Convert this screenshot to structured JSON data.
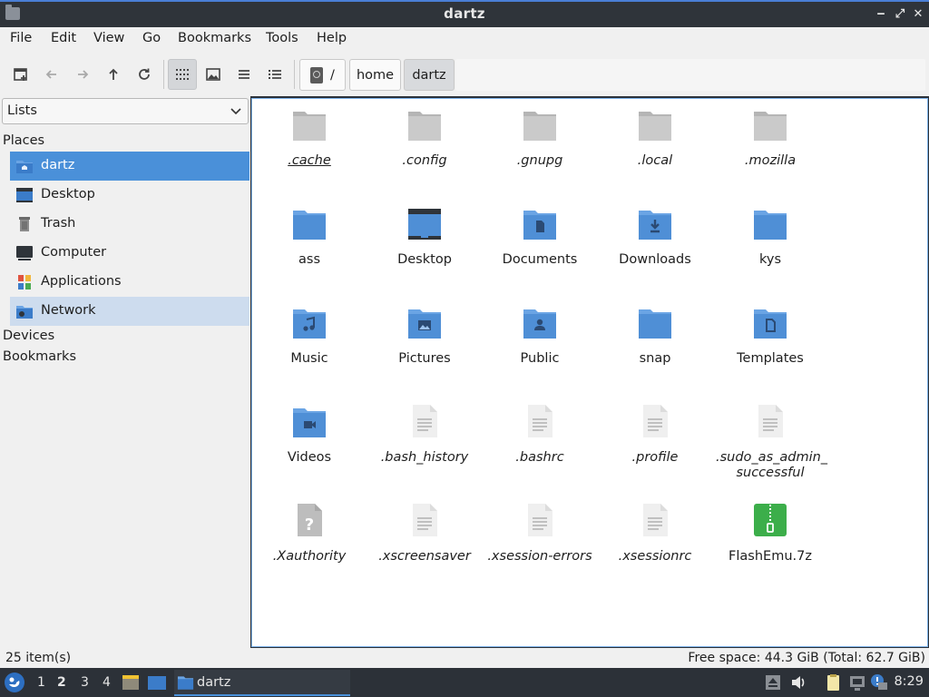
{
  "window": {
    "title": "dartz"
  },
  "menu": [
    "File",
    "Edit",
    "View",
    "Go",
    "Bookmarks",
    "Tools",
    "Help"
  ],
  "toolbar": {
    "buttons": [
      "new-tab-icon",
      "back-icon",
      "forward-icon",
      "up-icon",
      "reload-icon",
      "icon-view-icon",
      "thumbnail-view-icon",
      "compact-view-icon",
      "detailed-list-icon"
    ],
    "active_view": "icon-view-icon",
    "path": {
      "root": "/",
      "crumbs": [
        "home",
        "dartz"
      ],
      "current": "dartz"
    }
  },
  "sidebar": {
    "mode": "Lists",
    "places_label": "Places",
    "places": [
      {
        "label": "dartz",
        "icon": "home-folder-icon",
        "state": "selected"
      },
      {
        "label": "Desktop",
        "icon": "desktop-icon",
        "state": ""
      },
      {
        "label": "Trash",
        "icon": "trash-icon",
        "state": ""
      },
      {
        "label": "Computer",
        "icon": "computer-icon",
        "state": ""
      },
      {
        "label": "Applications",
        "icon": "applications-icon",
        "state": ""
      },
      {
        "label": "Network",
        "icon": "network-icon",
        "state": "hover"
      }
    ],
    "devices_label": "Devices",
    "bookmarks_label": "Bookmarks"
  },
  "files": [
    {
      "name": ".cache",
      "icon": "grey-folder-icon",
      "hidden": true
    },
    {
      "name": ".config",
      "icon": "grey-folder-icon",
      "hidden": true
    },
    {
      "name": ".gnupg",
      "icon": "grey-folder-icon",
      "hidden": true
    },
    {
      "name": ".local",
      "icon": "grey-folder-icon",
      "hidden": true
    },
    {
      "name": ".mozilla",
      "icon": "grey-folder-icon",
      "hidden": true
    },
    {
      "name": "ass",
      "icon": "folder-icon",
      "hidden": false
    },
    {
      "name": "Desktop",
      "icon": "desktop-folder-icon",
      "hidden": false
    },
    {
      "name": "Documents",
      "icon": "documents-folder-icon",
      "hidden": false
    },
    {
      "name": "Downloads",
      "icon": "downloads-folder-icon",
      "hidden": false
    },
    {
      "name": "kys",
      "icon": "folder-icon",
      "hidden": false
    },
    {
      "name": "Music",
      "icon": "music-folder-icon",
      "hidden": false
    },
    {
      "name": "Pictures",
      "icon": "pictures-folder-icon",
      "hidden": false
    },
    {
      "name": "Public",
      "icon": "public-folder-icon",
      "hidden": false
    },
    {
      "name": "snap",
      "icon": "folder-icon",
      "hidden": false
    },
    {
      "name": "Templates",
      "icon": "templates-folder-icon",
      "hidden": false
    },
    {
      "name": "Videos",
      "icon": "videos-folder-icon",
      "hidden": false
    },
    {
      "name": ".bash_history",
      "icon": "text-file-icon",
      "hidden": true
    },
    {
      "name": ".bashrc",
      "icon": "text-file-icon",
      "hidden": true
    },
    {
      "name": ".profile",
      "icon": "text-file-icon",
      "hidden": true
    },
    {
      "name": ".sudo_as_admin_\nsuccessful",
      "icon": "text-file-icon",
      "hidden": true
    },
    {
      "name": ".Xauthority",
      "icon": "unknown-file-icon",
      "hidden": true
    },
    {
      "name": ".xscreensaver",
      "icon": "text-file-icon",
      "hidden": true
    },
    {
      "name": ".xsession-errors",
      "icon": "text-file-icon",
      "hidden": true
    },
    {
      "name": ".xsessionrc",
      "icon": "text-file-icon",
      "hidden": true
    },
    {
      "name": "FlashEmu.7z",
      "icon": "archive-file-icon",
      "hidden": false
    }
  ],
  "status": {
    "count": "25 item(s)",
    "free": "Free space: 44.3 GiB (Total: 62.7 GiB)"
  },
  "taskbar": {
    "workspaces": [
      "1",
      "2",
      "3",
      "4"
    ],
    "current_workspace": "2",
    "task_label": "dartz",
    "clock": "8:29"
  },
  "colors": {
    "accent": "#4a90d9",
    "folder": "#4f8fd6",
    "grey_folder": "#c4c4c4",
    "archive": "#3cae4a",
    "taskbar": "#2c3138"
  }
}
